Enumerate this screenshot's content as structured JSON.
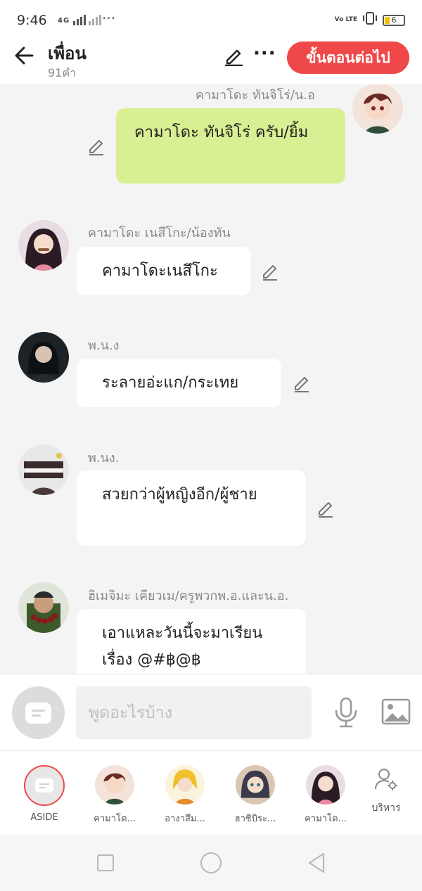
{
  "status_bar": {
    "time": "9:46",
    "network": "4G",
    "more": "···",
    "volte": "Vo LTE",
    "battery": "6"
  },
  "header": {
    "title": "เพื่อน",
    "subtitle": "91คำ",
    "more": "···",
    "next_button": "ขั้นตอนต่อไป"
  },
  "messages": [
    {
      "author": "คามาโดะ ทันจิโร่/น.อ",
      "text": "คามาโดะ ทันจิโร่ ครับ/ยิ้ม",
      "side": "right"
    },
    {
      "author": "คามาโดะ เนสึโกะ/น้องทัน",
      "text": "คามาโดะเนสึโกะ",
      "side": "left"
    },
    {
      "author": "พ.น.ง",
      "text": "ระลายอ่ะแก/กระเทย",
      "side": "left"
    },
    {
      "author": "พ.นง.",
      "text": "สวยกว่าผู้หญิงอีก/ผู้ชาย",
      "side": "left"
    },
    {
      "author": "ฮิเมจิมะ เคียวเม/ครูพวกพ.อ.และน.อ.",
      "text": "เอาแหละวันนี้จะมาเรียนเรื่อง @#฿@฿",
      "side": "left"
    }
  ],
  "composer": {
    "placeholder": "พูดอะไรบ้าง",
    "value": ""
  },
  "characters": [
    {
      "label": "ASIDE"
    },
    {
      "label": "คามาโต..."
    },
    {
      "label": "อางาสึม..."
    },
    {
      "label": "ฮาชิบิระ..."
    },
    {
      "label": "คามาโต..."
    }
  ],
  "manage_label": "บริหาร",
  "colors": {
    "accent": "#f04848",
    "my_bubble": "#d8f093",
    "background": "#f4f4f4"
  }
}
